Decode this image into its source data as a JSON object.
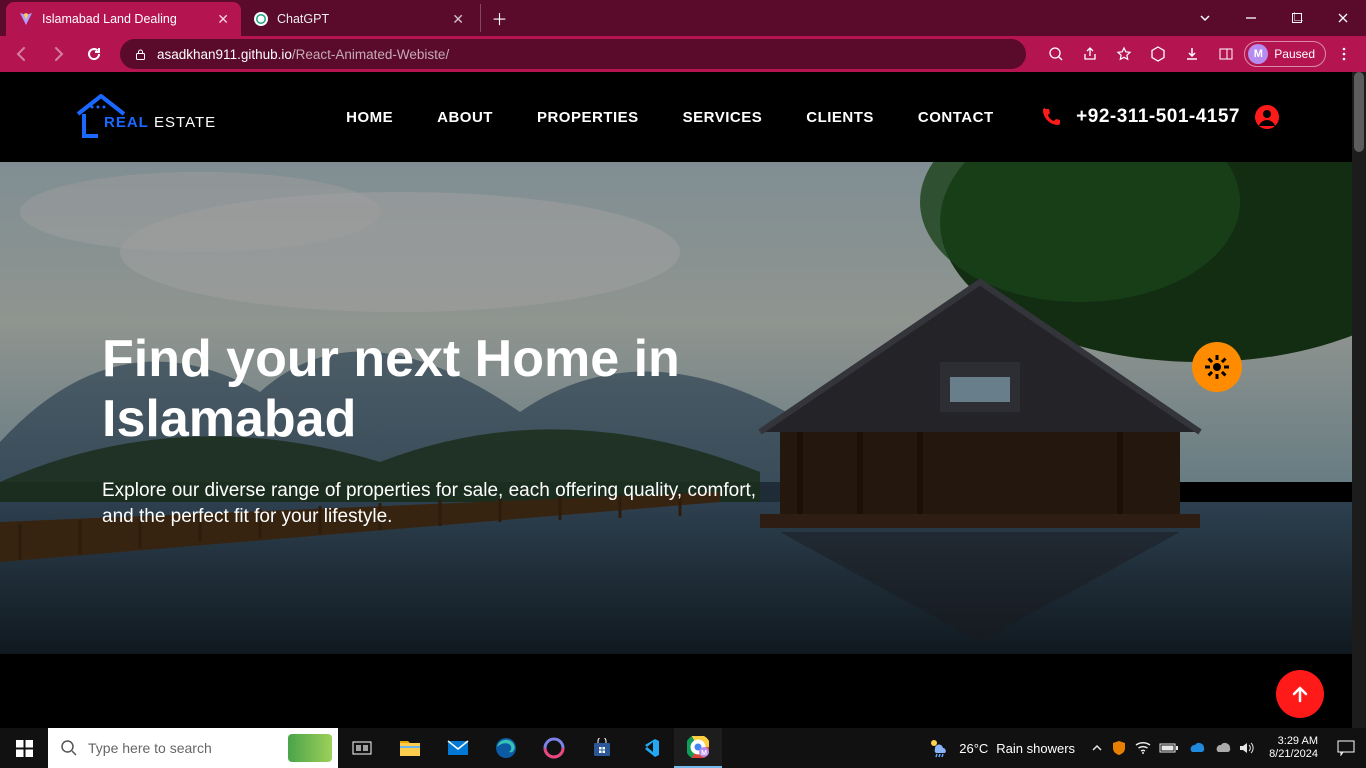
{
  "browser": {
    "tabs": [
      {
        "title": "Islamabad Land Dealing",
        "favicon": "V",
        "active": true
      },
      {
        "title": "ChatGPT",
        "favicon": "chatgpt",
        "active": false
      }
    ],
    "url_host": "asadkhan911.github.io",
    "url_path": "/React-Animated-Webiste/",
    "profile_initial": "M",
    "profile_status": "Paused"
  },
  "site": {
    "logo_main": "REAL",
    "logo_sub": " ESTATE",
    "nav": [
      "HOME",
      "ABOUT",
      "PROPERTIES",
      "SERVICES",
      "CLIENTS",
      "CONTACT"
    ],
    "phone": "+92-311-501-4157"
  },
  "hero": {
    "title": "Find your next Home in Islamabad",
    "subtitle": "Explore our diverse range of properties for sale, each offering quality, comfort, and the perfect fit for your lifestyle."
  },
  "taskbar": {
    "search_placeholder": "Type here to search",
    "weather_temp": "26°C",
    "weather_label": "Rain showers",
    "time": "3:29 AM",
    "date": "8/21/2024"
  }
}
